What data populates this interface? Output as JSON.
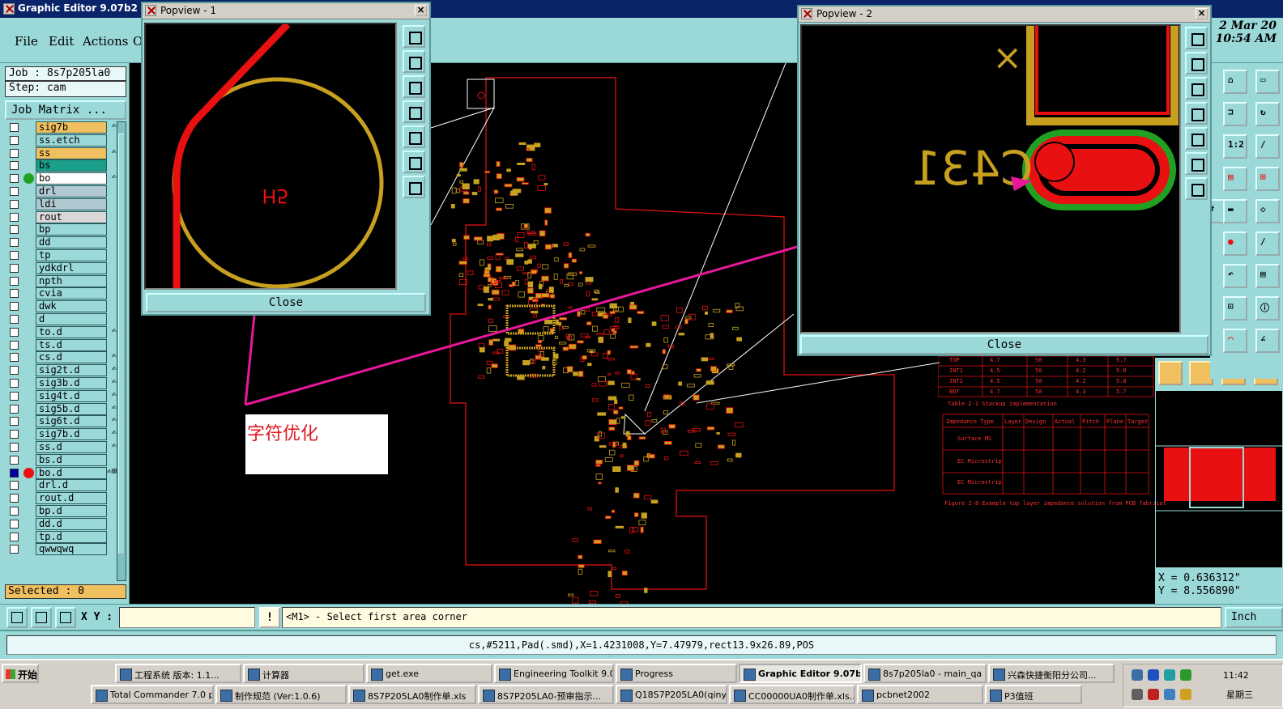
{
  "window": {
    "title": "Graphic Editor 9.07b2 (00@"
  },
  "menu": {
    "file": "File",
    "edit": "Edit",
    "actions": "Actions",
    "more": "O"
  },
  "datetime": {
    "date": "2 Mar 20",
    "time": "10:54 AM"
  },
  "left_panel": {
    "job": "Job : 8s7p205la0",
    "step": "Step: cam",
    "job_matrix": "Job Matrix ...",
    "selected": "Selected : 0",
    "layers": [
      {
        "name": "sig7b",
        "color": "#f0c060",
        "mark": "✍"
      },
      {
        "name": "ss.etch",
        "color": "#9bd8d8",
        "mark": ""
      },
      {
        "name": "ss",
        "color": "#f0c060",
        "mark": "✍"
      },
      {
        "name": "bs",
        "color": "#1aa08a",
        "mark": ""
      },
      {
        "name": "bo",
        "color": "#ffffff",
        "mark": "✍",
        "dot": "#22a022"
      },
      {
        "name": "drl",
        "color": "#b0c8d0",
        "mark": ""
      },
      {
        "name": "ldi",
        "color": "#b0c8d0",
        "mark": ""
      },
      {
        "name": "rout",
        "color": "#d8d8d8",
        "mark": ""
      },
      {
        "name": "bp",
        "color": "#9bd8d8",
        "mark": ""
      },
      {
        "name": "dd",
        "color": "#9bd8d8",
        "mark": ""
      },
      {
        "name": "tp",
        "color": "#9bd8d8",
        "mark": ""
      },
      {
        "name": "ydkdrl",
        "color": "#9bd8d8",
        "mark": ""
      },
      {
        "name": "npth",
        "color": "#9bd8d8",
        "mark": ""
      },
      {
        "name": "cvia",
        "color": "#9bd8d8",
        "mark": ""
      },
      {
        "name": "dwk",
        "color": "#9bd8d8",
        "mark": ""
      },
      {
        "name": "d",
        "color": "#9bd8d8",
        "mark": ""
      },
      {
        "name": "to.d",
        "color": "#9bd8d8",
        "mark": "✍"
      },
      {
        "name": "ts.d",
        "color": "#9bd8d8",
        "mark": ""
      },
      {
        "name": "cs.d",
        "color": "#9bd8d8",
        "mark": "✍"
      },
      {
        "name": "sig2t.d",
        "color": "#9bd8d8",
        "mark": "✍"
      },
      {
        "name": "sig3b.d",
        "color": "#9bd8d8",
        "mark": "✍"
      },
      {
        "name": "sig4t.d",
        "color": "#9bd8d8",
        "mark": "✍"
      },
      {
        "name": "sig5b.d",
        "color": "#9bd8d8",
        "mark": "✍"
      },
      {
        "name": "sig6t.d",
        "color": "#9bd8d8",
        "mark": "✍"
      },
      {
        "name": "sig7b.d",
        "color": "#9bd8d8",
        "mark": "✍"
      },
      {
        "name": "ss.d",
        "color": "#9bd8d8",
        "mark": "✍"
      },
      {
        "name": "bs.d",
        "color": "#9bd8d8",
        "mark": ""
      },
      {
        "name": "bo.d",
        "color": "#9bd8d8",
        "mark": "✍⊞",
        "dot": "#e81010",
        "sel": true
      },
      {
        "name": "drl.d",
        "color": "#9bd8d8",
        "mark": ""
      },
      {
        "name": "rout.d",
        "color": "#9bd8d8",
        "mark": ""
      },
      {
        "name": "bp.d",
        "color": "#9bd8d8",
        "mark": ""
      },
      {
        "name": "dd.d",
        "color": "#9bd8d8",
        "mark": ""
      },
      {
        "name": "tp.d",
        "color": "#9bd8d8",
        "mark": ""
      },
      {
        "name": "qwwqwq",
        "color": "#9bd8d8",
        "mark": ""
      }
    ]
  },
  "popview1": {
    "title": "Popview - 1",
    "close": "Close",
    "label": "H5"
  },
  "popview2": {
    "title": "Popview - 2",
    "close": "Close",
    "label": "C431"
  },
  "annotation": {
    "text": "字符优化"
  },
  "coords": {
    "x": "X = 0.636312\"",
    "y": "Y = 8.556890\""
  },
  "cmdbar": {
    "xy_label": "X Y :",
    "xy_value": "",
    "excl": "!",
    "prompt": "<M1> - Select first area corner",
    "unit": "Inch"
  },
  "status": {
    "text": "cs,#5211,Pad(.smd),X=1.4231008,Y=7.47979,rect13.9x26.89,POS"
  },
  "table": {
    "rows1": [
      [
        "TOP",
        "4.7",
        "50",
        "4.3",
        "5.7"
      ],
      [
        "INT1",
        "4.5",
        "50",
        "4.2",
        "5.8"
      ],
      [
        "INT2",
        "4.5",
        "50",
        "4.2",
        "5.8"
      ],
      [
        "BOT",
        "4.7",
        "50",
        "4.3",
        "5.7"
      ]
    ],
    "caption1": "Table 2-1 Stackup implementation",
    "headers": [
      "Impedance Type",
      "Layer",
      "Design",
      "Actual",
      "Pitch",
      "Plane",
      "Target"
    ],
    "row_a": "Surface MS",
    "row_b": "EC Microstrip",
    "row_c": "EC Microstrip",
    "caption2": "Figure 2-8 Example top layer impedance solution from PCB fabricat"
  },
  "taskbar": {
    "start": "开始",
    "row1": [
      "工程系统 版本: 1.1...",
      "计算器",
      "get.exe",
      "Engineering Toolkit 9.0...",
      "Progress",
      "Graphic Editor 9.07b...",
      "8s7p205la0 - main_qa",
      "兴森快捷衡阳分公司..."
    ],
    "row2": [
      "Total Commander 7.0 pu...",
      "制作规范 (Ver:1.0.6)",
      "8S7P205LA0制作单.xls",
      "8S7P205LA0-预审指示...",
      "Q18S7P205LA0(qinyp)2...",
      "CC00000UA0制作单.xls...",
      "pcbnet2002",
      "P3值班"
    ],
    "time": "11:42",
    "day": "星期三"
  },
  "colors": {
    "accent": "#9bd8d8",
    "trace_red": "#e81010",
    "silk_yellow": "#c8a020",
    "magenta_arrow": "#e8189a"
  }
}
